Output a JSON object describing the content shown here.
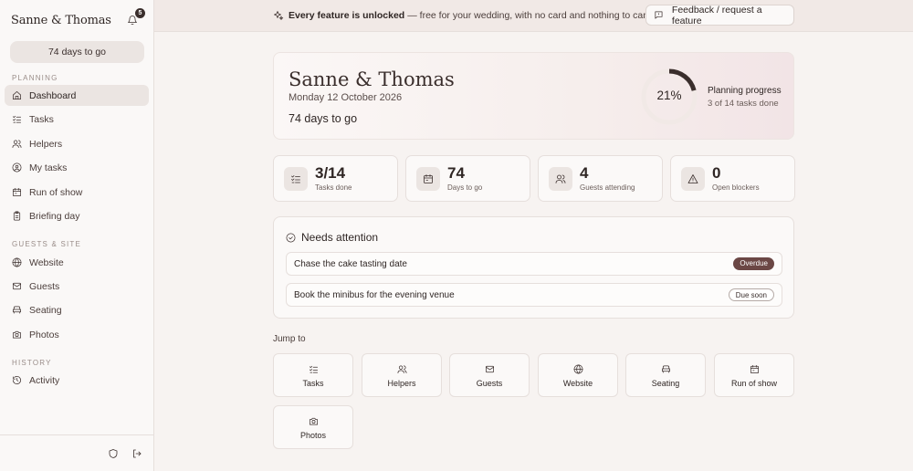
{
  "sidebar": {
    "brand": "Sanne & Thomas",
    "notification_count": "5",
    "days_pill": "74 days to go",
    "sections": {
      "planning": "PLANNING",
      "guests_site": "GUESTS & SITE",
      "history": "HISTORY"
    },
    "items": [
      {
        "label": "Dashboard",
        "icon": "home-icon",
        "active": true
      },
      {
        "label": "Tasks",
        "icon": "list-check-icon"
      },
      {
        "label": "Helpers",
        "icon": "users-icon"
      },
      {
        "label": "My tasks",
        "icon": "user-circle-icon"
      },
      {
        "label": "Run of show",
        "icon": "calendar-icon"
      },
      {
        "label": "Briefing day",
        "icon": "clipboard-icon"
      },
      {
        "label": "Website",
        "icon": "globe-icon"
      },
      {
        "label": "Guests",
        "icon": "mail-icon"
      },
      {
        "label": "Seating",
        "icon": "sofa-icon"
      },
      {
        "label": "Photos",
        "icon": "camera-icon"
      },
      {
        "label": "Activity",
        "icon": "history-icon"
      }
    ]
  },
  "topbar": {
    "message_bold": "Every feature is unlocked",
    "message_rest": "— free for your wedding, with no card and nothing to cancel.",
    "feedback_label": "Feedback / request a feature"
  },
  "hero": {
    "title": "Sanne & Thomas",
    "date": "Monday 12 October 2026",
    "days": "74 days to go",
    "progress_pct": "21%",
    "progress_fraction": 0.21,
    "progress_title": "Planning progress",
    "progress_sub": "3 of 14 tasks done"
  },
  "stats": [
    {
      "value": "3/14",
      "label": "Tasks done",
      "icon": "list-check-icon"
    },
    {
      "value": "74",
      "label": "Days to go",
      "icon": "calendar-icon"
    },
    {
      "value": "4",
      "label": "Guests attending",
      "icon": "users-icon"
    },
    {
      "value": "0",
      "label": "Open blockers",
      "icon": "warning-icon"
    }
  ],
  "attention": {
    "title": "Needs attention",
    "items": [
      {
        "text": "Chase the cake tasting date",
        "badge": "Overdue"
      },
      {
        "text": "Book the minibus for the evening venue",
        "badge": "Due soon"
      }
    ]
  },
  "jump": {
    "title": "Jump to",
    "items": [
      {
        "label": "Tasks",
        "icon": "list-check-icon"
      },
      {
        "label": "Helpers",
        "icon": "users-icon"
      },
      {
        "label": "Guests",
        "icon": "mail-icon"
      },
      {
        "label": "Website",
        "icon": "globe-icon"
      },
      {
        "label": "Seating",
        "icon": "sofa-icon"
      },
      {
        "label": "Run of show",
        "icon": "calendar-icon"
      },
      {
        "label": "Photos",
        "icon": "camera-icon"
      }
    ]
  },
  "colors": {
    "accent_dark": "#6b4745",
    "background": "#f7f3f1",
    "text": "#3a2e2c"
  }
}
